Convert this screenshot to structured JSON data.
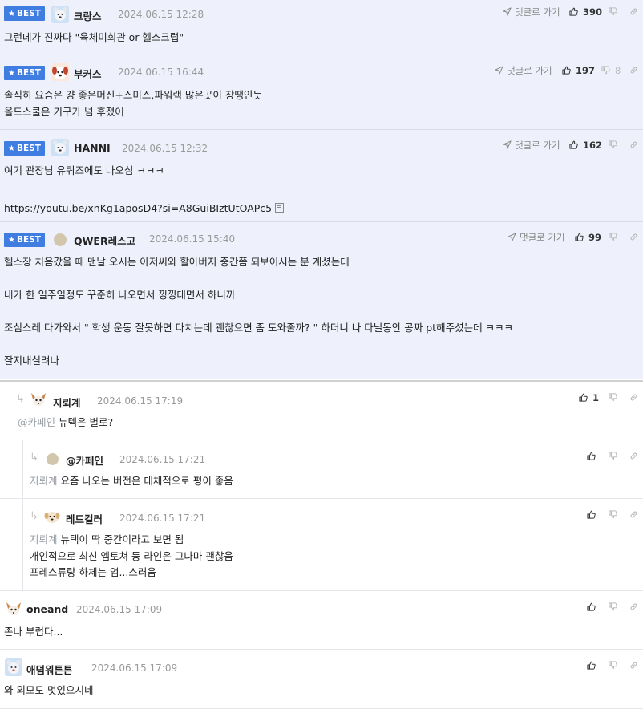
{
  "labels": {
    "best": "BEST",
    "goto_reply": "댓글로 가기"
  },
  "colors": {
    "best_badge": "#3f7de0",
    "best_bg": "#eef1fb",
    "mention": "#9aa0a6"
  },
  "comments": [
    {
      "best": true,
      "nick": "크랑스",
      "avatar": "bear-avatar-icon",
      "date": "2024.06.15 12:28",
      "likes": "390",
      "dislikes": "",
      "lines": [
        "그런데가 진짜다 \"육체미회관 or 헬스크럽\""
      ]
    },
    {
      "best": true,
      "nick": "부커스",
      "avatar": "dog-avatar-icon",
      "date": "2024.06.15 16:44",
      "likes": "197",
      "dislikes": "8",
      "lines": [
        "솔직히 요즘은 걍 좋은머신+스미스,파워랙 많은곳이 장땡인듯",
        "올드스쿨은 기구가 넘 후졌어"
      ]
    },
    {
      "best": true,
      "nick": "HANNI",
      "avatar": "bear-avatar-icon",
      "date": "2024.06.15 12:32",
      "likes": "162",
      "dislikes": "",
      "lines": [
        "여기 관장님 유퀴즈에도 나오심 ㅋㅋㅋ",
        "",
        "https://youtu.be/xnKg1aposD4?si=A8GuiBIztUtOAPc5"
      ]
    },
    {
      "best": true,
      "nick": "QWER레스고",
      "avatar": "circle-avatar-icon",
      "date": "2024.06.15 15:40",
      "likes": "99",
      "dislikes": "",
      "lines": [
        "헬스장 처음갔을 때 맨날 오시는 아저씨와 할아버지 중간쯤 되보이시는 분 계셨는데",
        "",
        "내가 한 일주일정도 꾸준히 나오면서 낑낑대면서 하니까",
        "",
        "조심스레 다가와서 \" 학생 운동 잘못하면 다치는데 괜찮으면 좀 도와줄까? \" 하더니 나 다닐동안 공짜 pt해주셨는데 ㅋㅋㅋ",
        "",
        "잘지내실려나"
      ]
    },
    {
      "best": false,
      "nick": "지뢰계",
      "avatar": "chihuahua-avatar-icon",
      "date": "2024.06.15 17:19",
      "likes": "1",
      "mention": "@카페인",
      "lines": [
        "뉴텍은 별로?"
      ]
    },
    {
      "best": false,
      "nick": "@카페인",
      "avatar": "circle-avatar-icon",
      "date": "2024.06.15 17:21",
      "likes": "",
      "mention": "지뢰계",
      "lines": [
        "요즘 나오는 버전은 대체적으로 평이 좋음"
      ]
    },
    {
      "best": false,
      "nick": "레드컬러",
      "avatar": "puppy-avatar-icon",
      "date": "2024.06.15 17:21",
      "likes": "",
      "mention": "지뢰계",
      "lines": [
        "뉴텍이 딱 중간이라고 보면 됨",
        "개인적으로 최신 엠토쳐 등 라인은 그나마 괜찮음",
        "프레스류랑 하체는 엄...스러움"
      ]
    },
    {
      "best": false,
      "nick": "oneand",
      "avatar": "chihuahua-avatar-icon",
      "date": "2024.06.15 17:09",
      "likes": "",
      "lines": [
        "존나 부럽다..."
      ]
    },
    {
      "best": false,
      "nick": "애덤워튼튼",
      "avatar": "bear-avatar-icon",
      "date": "2024.06.15 17:09",
      "likes": "",
      "lines": [
        "와 외모도 멋있으시네"
      ]
    }
  ]
}
